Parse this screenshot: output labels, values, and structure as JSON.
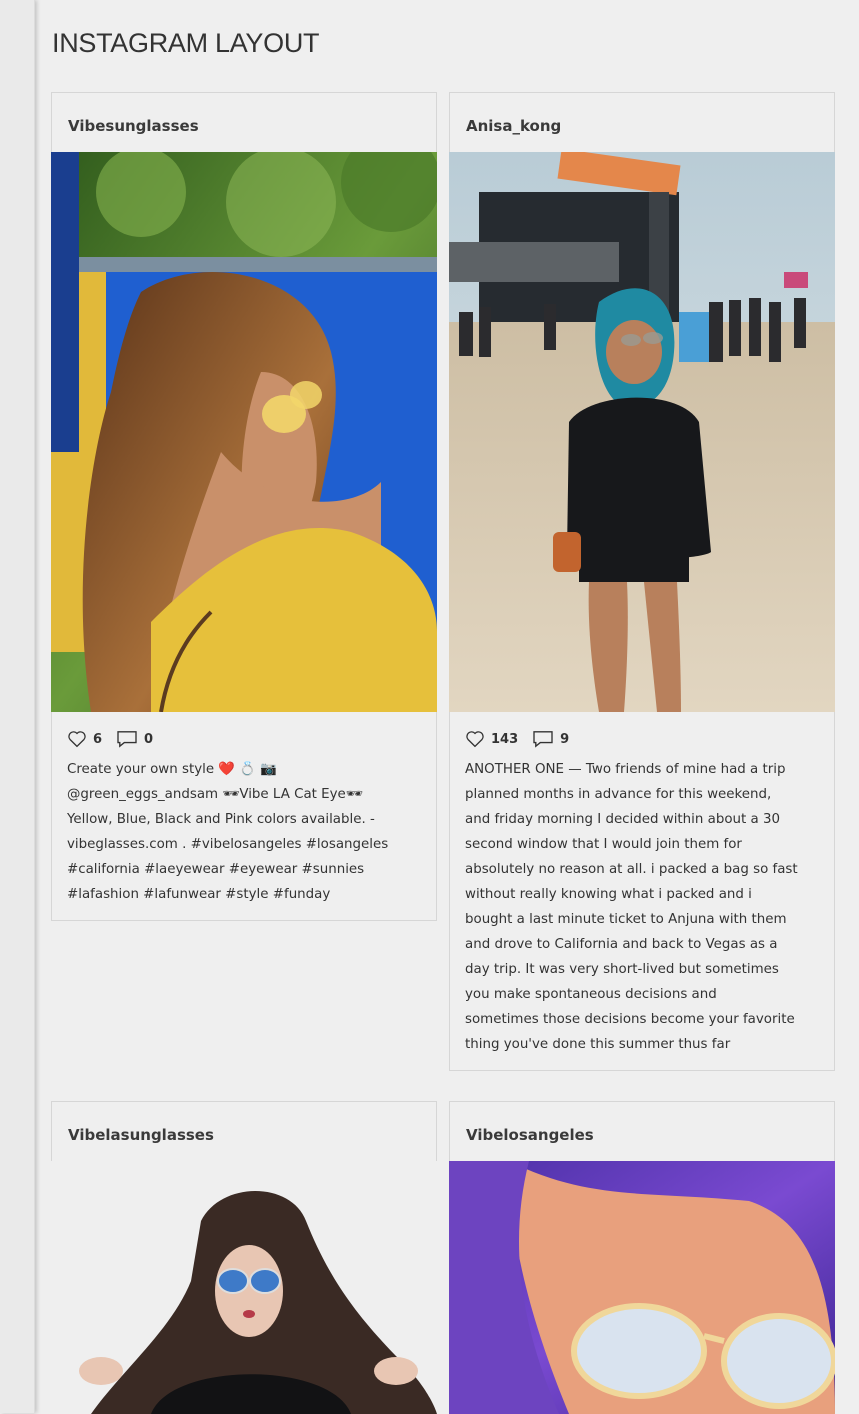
{
  "page": {
    "title": "INSTAGRAM LAYOUT"
  },
  "posts": [
    {
      "username": "Vibesunglasses",
      "likes": "6",
      "comments": "0",
      "caption": "Create your own style ❤️ 💍 📷\n@green_eggs_andsam 🕶Vibe LA Cat Eye🕶\n Yellow, Blue, Black and Pink colors available. -\nvibeglasses.com . #vibelosangeles #losangeles\n#california #laeyewear #eyewear #sunnies\n#lafashion #lafunwear #style #funday"
    },
    {
      "username": "Anisa_kong",
      "likes": "143",
      "comments": "9",
      "caption": "ANOTHER ONE — Two friends of mine had a trip\nplanned months in advance for this weekend,\nand friday morning I decided within about a 30\nsecond window that I would join them for\nabsolutely no reason at all. i packed a bag so fast\nwithout really knowing what i packed and i\nbought a last minute ticket to Anjuna with them\nand drove to California and back to Vegas as a\nday trip. It was very short-lived but sometimes\nyou make spontaneous decisions and\nsometimes those decisions become your favorite\nthing you've done this summer thus far"
    },
    {
      "username": "Vibelasunglasses"
    },
    {
      "username": "Vibelosangeles"
    }
  ],
  "icons": {
    "like": "heart-icon",
    "comment": "comment-icon"
  }
}
